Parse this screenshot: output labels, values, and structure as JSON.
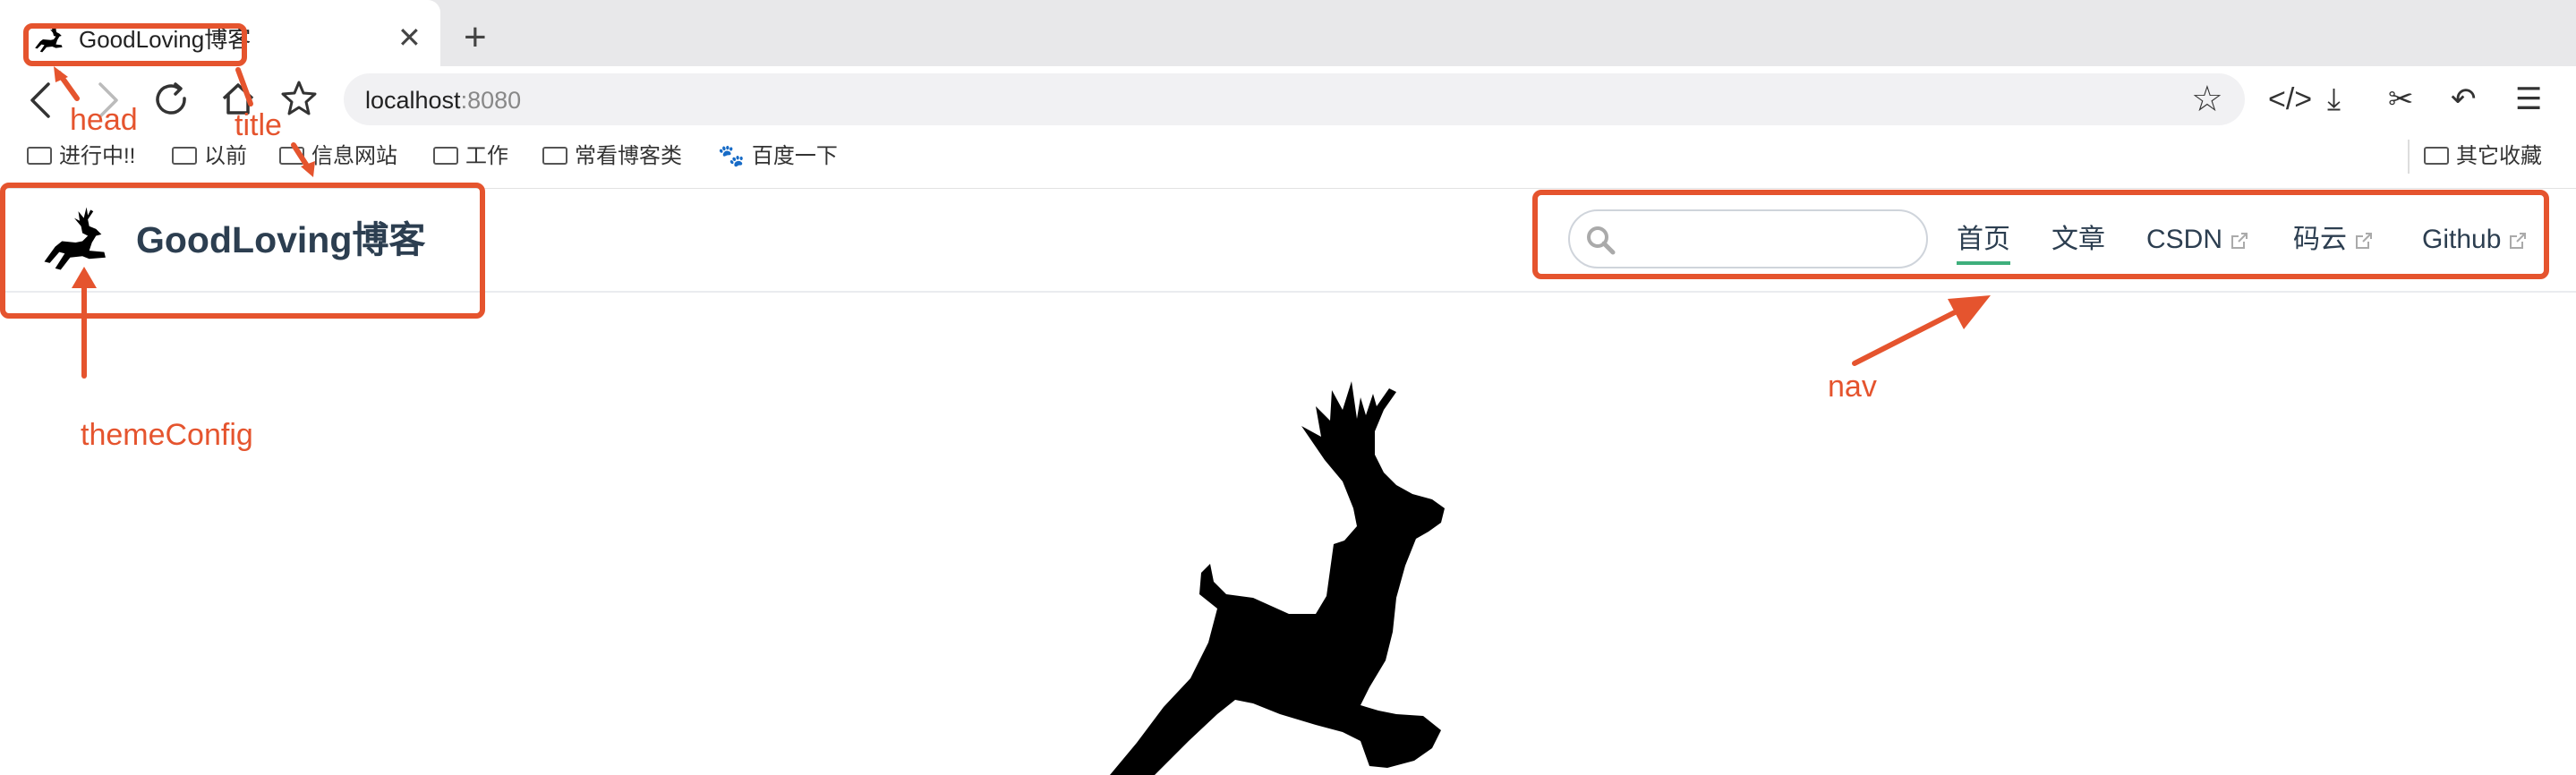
{
  "browser": {
    "tab": {
      "title": "GoodLoving博客",
      "close": "✕"
    },
    "new_tab": "+",
    "nav": {
      "back": "‹",
      "forward": "›",
      "reload": "⟳",
      "home": "⌂"
    },
    "url": {
      "host": "localhost",
      "port": ":8080"
    },
    "bookmark_star": "☆",
    "tools": [
      "</>",
      "⤓",
      "✂",
      "↶",
      "☰"
    ],
    "bookmarks": [
      {
        "label": "进行中!!",
        "icon": "folder-icon"
      },
      {
        "label": "以前",
        "icon": "folder-icon"
      },
      {
        "label": "信息网站",
        "icon": "folder-icon"
      },
      {
        "label": "工作",
        "icon": "folder-icon"
      },
      {
        "label": "常看博客类",
        "icon": "folder-icon"
      },
      {
        "label": "百度一下",
        "icon": "baidu-paw-icon"
      }
    ],
    "other_bookmarks": "其它收藏"
  },
  "site": {
    "title": "GoodLoving博客",
    "search": {
      "placeholder": ""
    },
    "nav": [
      {
        "label": "首页",
        "active": true
      },
      {
        "label": "文章"
      },
      {
        "label": "CSDN",
        "external": true
      },
      {
        "label": "码云",
        "external": true
      },
      {
        "label": "Github",
        "external": true
      }
    ]
  },
  "annotations": {
    "head": "head",
    "title": "title",
    "theme_config": "themeConfig",
    "nav": "nav",
    "color": "#e5542e"
  },
  "colors": {
    "accent": "#3eaf7c",
    "text": "#2c3e50"
  }
}
